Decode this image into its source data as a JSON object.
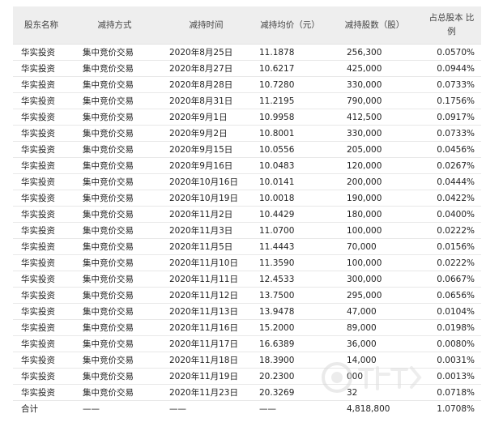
{
  "table": {
    "headers": [
      "股东名称",
      "减持方式",
      "减持时间",
      "减持均价（元）",
      "减持股数（股）",
      "占总股本 比例"
    ],
    "rows": [
      [
        "华实投资",
        "集中竞价交易",
        "2020年8月25日",
        "11.1878",
        "256,300",
        "0.0570%"
      ],
      [
        "华实投资",
        "集中竞价交易",
        "2020年8月27日",
        "10.6217",
        "425,000",
        "0.0944%"
      ],
      [
        "华实投资",
        "集中竞价交易",
        "2020年8月28日",
        "10.7280",
        "330,000",
        "0.0733%"
      ],
      [
        "华实投资",
        "集中竞价交易",
        "2020年8月31日",
        "11.2195",
        "790,000",
        "0.1756%"
      ],
      [
        "华实投资",
        "集中竞价交易",
        "2020年9月1日",
        "10.9958",
        "412,500",
        "0.0917%"
      ],
      [
        "华实投资",
        "集中竞价交易",
        "2020年9月2日",
        "10.8001",
        "330,000",
        "0.0733%"
      ],
      [
        "华实投资",
        "集中竞价交易",
        "2020年9月15日",
        "10.0556",
        "205,000",
        "0.0456%"
      ],
      [
        "华实投资",
        "集中竞价交易",
        "2020年9月16日",
        "10.0483",
        "120,000",
        "0.0267%"
      ],
      [
        "华实投资",
        "集中竞价交易",
        "2020年10月16日",
        "10.0141",
        "200,000",
        "0.0444%"
      ],
      [
        "华实投资",
        "集中竞价交易",
        "2020年10月19日",
        "10.0018",
        "190,000",
        "0.0422%"
      ],
      [
        "华实投资",
        "集中竞价交易",
        "2020年11月2日",
        "10.4429",
        "180,000",
        "0.0400%"
      ],
      [
        "华实投资",
        "集中竞价交易",
        "2020年11月3日",
        "11.0700",
        "100,000",
        "0.0222%"
      ],
      [
        "华实投资",
        "集中竞价交易",
        "2020年11月5日",
        "11.4443",
        "70,000",
        "0.0156%"
      ],
      [
        "华实投资",
        "集中竞价交易",
        "2020年11月10日",
        "11.3590",
        "100,000",
        "0.0222%"
      ],
      [
        "华实投资",
        "集中竞价交易",
        "2020年11月11日",
        "12.4533",
        "300,000",
        "0.0667%"
      ],
      [
        "华实投资",
        "集中竞价交易",
        "2020年11月12日",
        "13.7500",
        "295,000",
        "0.0656%"
      ],
      [
        "华实投资",
        "集中竞价交易",
        "2020年11月13日",
        "13.9478",
        "47,000",
        "0.0104%"
      ],
      [
        "华实投资",
        "集中竞价交易",
        "2020年11月16日",
        "15.2000",
        "89,000",
        "0.0198%"
      ],
      [
        "华实投资",
        "集中竞价交易",
        "2020年11月17日",
        "16.6389",
        "36,000",
        "0.0080%"
      ],
      [
        "华实投资",
        "集中竞价交易",
        "2020年11月18日",
        "18.3900",
        "14,000",
        "0.0031%"
      ],
      [
        "华实投资",
        "集中竞价交易",
        "2020年11月19日",
        "20.2300",
        "000",
        "0.0013%"
      ],
      [
        "华实投资",
        "集中竞价交易",
        "2020年11月23日",
        "20.3269",
        "32",
        "0.0718%"
      ],
      [
        "合计",
        "——",
        "——",
        "——",
        "4,818,800",
        "1.0708%"
      ]
    ]
  },
  "colors": {
    "header_bg": "#eeeeee",
    "grid_line": "#e8e8e8",
    "text": "#222222"
  }
}
